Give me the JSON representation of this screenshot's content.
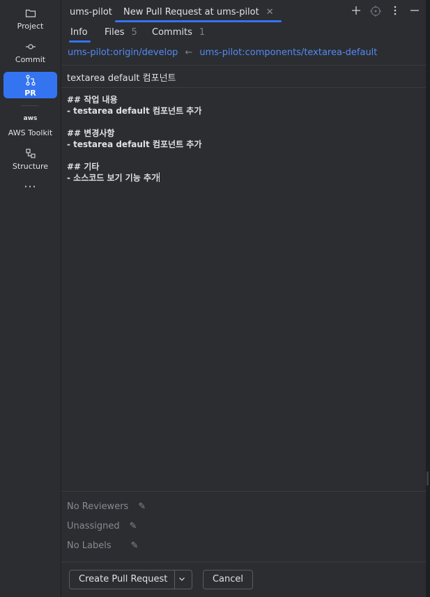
{
  "tool_strip": {
    "items": [
      {
        "label": "Project",
        "icon": "folder-icon"
      },
      {
        "label": "Commit",
        "icon": "commit-icon"
      },
      {
        "label": "PR",
        "icon": "pull-request-icon"
      },
      {
        "label": "AWS Toolkit",
        "icon": "aws-icon"
      },
      {
        "label": "Structure",
        "icon": "structure-icon"
      }
    ],
    "more_label": "···",
    "active": "PR"
  },
  "editor_tabs": [
    {
      "label": "ums-pilot"
    },
    {
      "label": "New Pull Request at ums-pilot",
      "closable": true
    }
  ],
  "top_actions": [
    "add-icon",
    "target-icon",
    "more-vertical-icon",
    "minimize-icon"
  ],
  "sub_tabs": [
    {
      "label": "Info",
      "count": ""
    },
    {
      "label": "Files",
      "count": "5"
    },
    {
      "label": "Commits",
      "count": "1"
    }
  ],
  "branches": {
    "base": "ums-pilot:origin/develop",
    "arrow": "←",
    "head": "ums-pilot:components/textarea-default"
  },
  "pr_title": "textarea default 컴포넌트",
  "description_lines": [
    "## 작업 내용",
    "- testarea default 컴포넌트 추가",
    "",
    "## 변경사항",
    "- testarea default 컴포넌트 추가",
    "",
    "## 기타",
    "- 소스코드 보기 기능 추가"
  ],
  "meta": {
    "reviewers": "No Reviewers",
    "assignee": "Unassigned",
    "labels": "No Labels"
  },
  "buttons": {
    "create": "Create Pull Request",
    "cancel": "Cancel"
  },
  "colors": {
    "accent": "#3574f0",
    "link": "#548af7",
    "panel_bg": "#2b2d30"
  }
}
